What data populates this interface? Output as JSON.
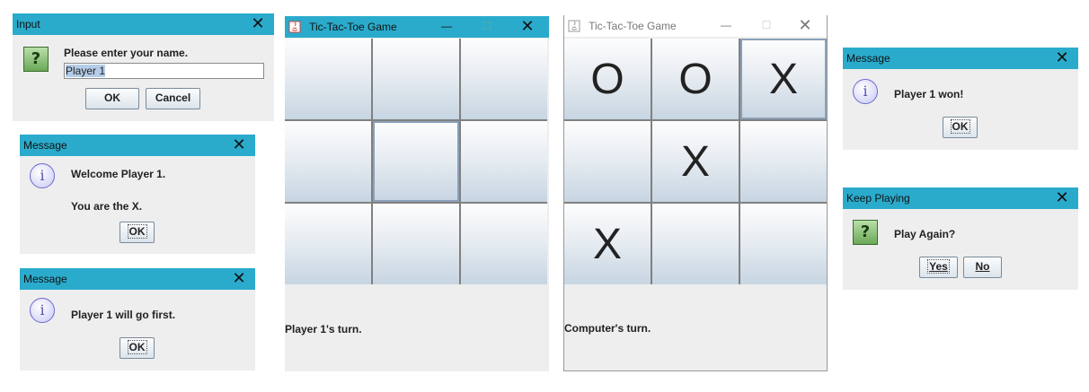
{
  "input_dialog": {
    "title": "Input",
    "prompt": "Please enter your name.",
    "value": "Player 1",
    "ok_label": "OK",
    "cancel_label": "Cancel"
  },
  "welcome_dialog": {
    "title": "Message",
    "line1": "Welcome Player 1.",
    "line2": "You are the X.",
    "ok_label": "OK"
  },
  "first_dialog": {
    "title": "Message",
    "text": "Player 1 will go first.",
    "ok_label": "OK"
  },
  "game1": {
    "title": "Tic-Tac-Toe Game",
    "cells": [
      "",
      "",
      "",
      "",
      "",
      "",
      "",
      "",
      ""
    ],
    "status": "Player 1's turn."
  },
  "game2": {
    "title": "Tic-Tac-Toe Game",
    "cells": [
      "O",
      "O",
      "X",
      "",
      "X",
      "",
      "X",
      "",
      ""
    ],
    "status": "Computer's turn."
  },
  "won_dialog": {
    "title": "Message",
    "text": "Player 1 won!",
    "ok_label": "OK"
  },
  "again_dialog": {
    "title": "Keep Playing",
    "text": "Play Again?",
    "yes_label": "Yes",
    "no_label": "No"
  },
  "colors": {
    "titlebar": "#2aabcc",
    "dialog_bg": "#eeeeee"
  }
}
